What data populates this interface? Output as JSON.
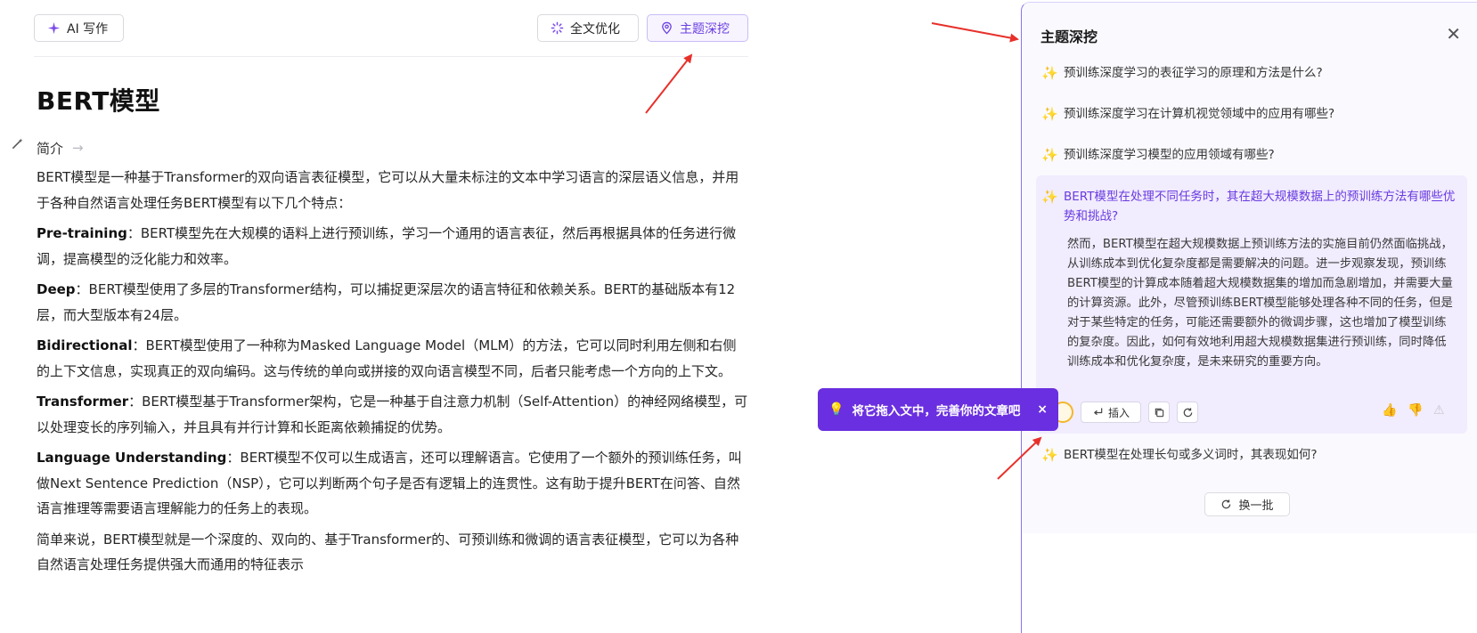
{
  "toolbar": {
    "ai_label": "AI 写作",
    "optimize_label": "全文优化",
    "topic_label": "主题深挖"
  },
  "doc": {
    "title": "BERT模型",
    "section": "简介",
    "intro": "BERT模型是一种基于Transformer的双向语言表征模型，它可以从大量未标注的文本中学习语言的深层语义信息，并用于各种自然语言处理任务BERT模型有以下几个特点：",
    "features": [
      {
        "term": "Pre-training",
        "text": "：BERT模型先在大规模的语料上进行预训练，学习一个通用的语言表征，然后再根据具体的任务进行微调，提高模型的泛化能力和效率。"
      },
      {
        "term": "Deep",
        "text": "：BERT模型使用了多层的Transformer结构，可以捕捉更深层次的语言特征和依赖关系。BERT的基础版本有12层，而大型版本有24层。"
      },
      {
        "term": "Bidirectional",
        "text": "：BERT模型使用了一种称为Masked Language Model（MLM）的方法，它可以同时利用左侧和右侧的上下文信息，实现真正的双向编码。这与传统的单向或拼接的双向语言模型不同，后者只能考虑一个方向的上下文。"
      },
      {
        "term": "Transformer",
        "text": "：BERT模型基于Transformer架构，它是一种基于自注意力机制（Self-Attention）的神经网络模型，可以处理变长的序列输入，并且具有并行计算和长距离依赖捕捉的优势。"
      },
      {
        "term": "Language Understanding",
        "text": "：BERT模型不仅可以生成语言，还可以理解语言。它使用了一个额外的预训练任务，叫做Next Sentence Prediction（NSP），它可以判断两个句子是否有逻辑上的连贯性。这有助于提升BERT在问答、自然语言推理等需要语言理解能力的任务上的表现。"
      }
    ],
    "summary": "简单来说，BERT模型就是一个深度的、双向的、基于Transformer的、可预训练和微调的语言表征模型，它可以为各种自然语言处理任务提供强大而通用的特征表示"
  },
  "panel": {
    "title": "主题深挖",
    "questions": [
      "预训练深度学习的表征学习的原理和方法是什么?",
      "预训练深度学习在计算机视觉领域中的应用有哪些?",
      "预训练深度学习模型的应用领域有哪些?"
    ],
    "active_question": "BERT模型在处理不同任务时，其在超大规模数据上的预训练方法有哪些优势和挑战?",
    "answer": "然而，BERT模型在超大规模数据上预训练方法的实施目前仍然面临挑战，从训练成本到优化复杂度都是需要解决的问题。进一步观察发现，预训练BERT模型的计算成本随着超大规模数据集的增加而急剧增加，并需要大量的计算资源。此外，尽管预训练BERT模型能够处理各种不同的任务，但是对于某些特定的任务，可能还需要额外的微调步骤，这也增加了模型训练的复杂度。因此，如何有效地利用超大规模数据集进行预训练，同时降低训练成本和优化复杂度，是未来研究的重要方向。",
    "insert_label": "插入",
    "last_question": "BERT模型在处理长句或多义词时，其表现如何?",
    "refresh_label": "换一批"
  },
  "tooltip": {
    "text": "将它拖入文中，完善你的文章吧",
    "close": "×"
  },
  "colors": {
    "accent": "#6a2fe0",
    "annotation": "#e8302a",
    "spark": "#f3b62a"
  }
}
